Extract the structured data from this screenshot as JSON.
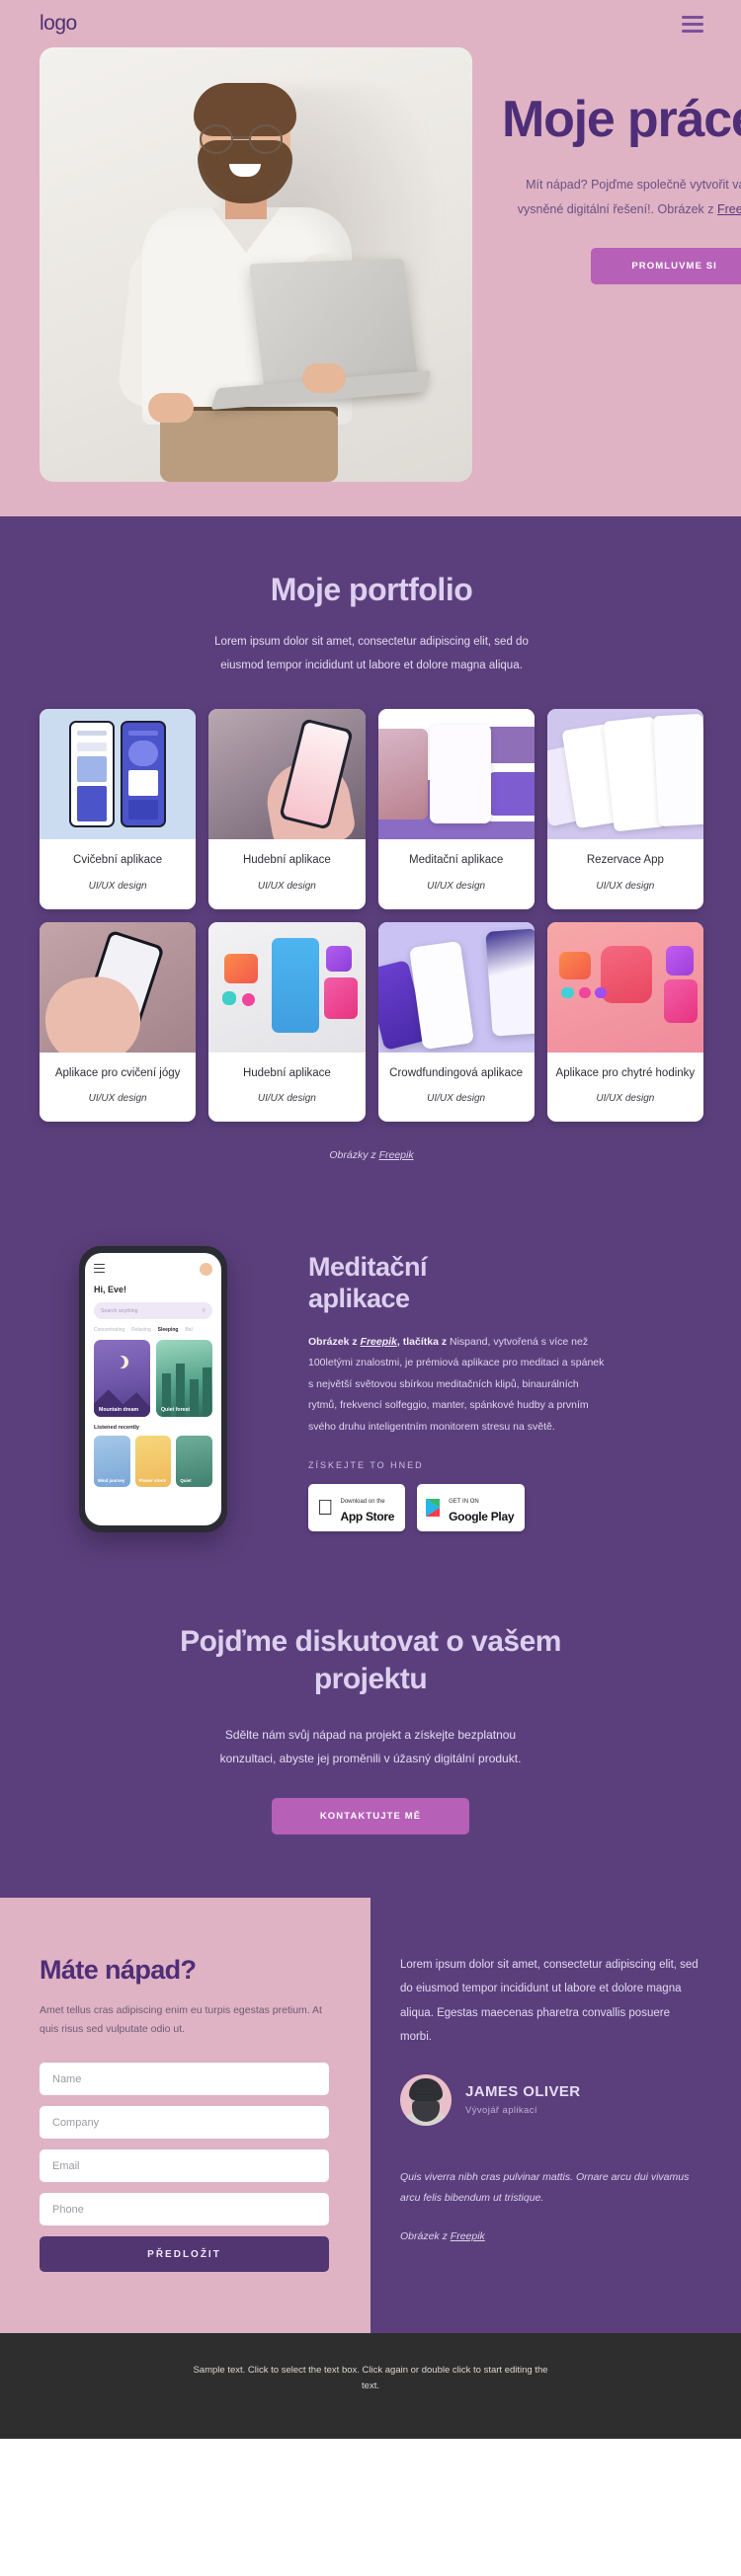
{
  "header": {
    "logo": "logo",
    "menu_icon": "hamburger-icon"
  },
  "hero": {
    "title": "Moje práce",
    "subtitle_line1": "Mít nápad? Pojďme společně vytvořit vaše",
    "subtitle_line2": "vysněné digitální řešení!. Obrázek z ",
    "subtitle_link": "Freepik",
    "button": "PROMLUVME SI"
  },
  "portfolio": {
    "title": "Moje portfolio",
    "subtitle_line1": "Lorem ipsum dolor sit amet, consectetur adipiscing elit, sed do",
    "subtitle_line2": "eiusmod tempor incididunt ut labore et dolore magna aliqua.",
    "cards": [
      {
        "name": "Cvičební aplikace",
        "tag": "UI/UX design"
      },
      {
        "name": "Hudební aplikace",
        "tag": "UI/UX design"
      },
      {
        "name": "Meditační aplikace",
        "tag": "UI/UX design"
      },
      {
        "name": "Rezervace  App",
        "tag": "UI/UX design"
      },
      {
        "name": "Aplikace pro cvičení jógy",
        "tag": "UI/UX design"
      },
      {
        "name": "Hudební aplikace",
        "tag": "UI/UX design"
      },
      {
        "name": "Crowdfundingová aplikace",
        "tag": "UI/UX design"
      },
      {
        "name": "Aplikace pro chytré hodinky",
        "tag": "UI/UX design"
      }
    ],
    "credit_prefix": "Obrázky z ",
    "credit_link": "Freepik"
  },
  "meditation": {
    "title_line1": "Meditační",
    "title_line2": "aplikace",
    "body_bold": "Obrázek z ",
    "body_link": "Freepik",
    "body_bold2": ", tlačítka z ",
    "body_rest": " Nispand, vytvořená s více než 100letými znalostmi, je prémiová aplikace pro meditaci a spánek s největší světovou sbírkou meditačních klipů, binaurálních rytmů, frekvencí solfeggio, manter, spánkové hudby a prvním svého druhu inteligentním monitorem stresu na světě.",
    "cta_label": "ZÍSKEJTE TO HNED",
    "appstore_small": "Download on the",
    "appstore_big": "App Store",
    "googleplay_small": "GET IN ON",
    "googleplay_big": "Google Play",
    "phone": {
      "greeting": "Hi, Eve!",
      "search_placeholder": "Search anything",
      "tabs": [
        "Concentrating",
        "Relaxing",
        "Sleeping",
        "Bal"
      ],
      "active_tab": "Sleeping",
      "card1": "Mountain dream",
      "card2": "Quiet forest",
      "recent_label": "Listened recently",
      "recent": [
        "Mind journey",
        "Flower storm",
        "Quiet"
      ]
    }
  },
  "discuss": {
    "title_line1": "Pojďme diskutovat o vašem",
    "title_line2": "projektu",
    "body_line1": "Sdělte nám svůj nápad na projekt a získejte bezplatnou",
    "body_line2": "konzultaci, abyste jej proměnili v úžasný digitální produkt.",
    "button": "KONTAKTUJTE MĚ"
  },
  "contact": {
    "title": "Máte nápad?",
    "description": "Amet tellus cras adipiscing enim eu turpis egestas pretium. At quis risus sed vulputate odio ut.",
    "fields": [
      {
        "placeholder": "Name",
        "value": ""
      },
      {
        "placeholder": "Company",
        "value": ""
      },
      {
        "placeholder": "Email",
        "value": ""
      },
      {
        "placeholder": "Phone",
        "value": ""
      }
    ],
    "submit": "PŘEDLOŽIT",
    "quote": "Lorem ipsum dolor sit amet, consectetur adipiscing elit, sed do eiusmod tempor incididunt ut labore et dolore magna aliqua. Egestas maecenas pharetra convallis posuere morbi.",
    "person_name": "JAMES OLIVER",
    "person_role": "Vývojář aplikací",
    "quote2": "Quis viverra nibh cras pulvinar mattis. Ornare arcu dui vivamus arcu felis bibendum ut tristique.",
    "credit_prefix": "Obrázek z ",
    "credit_link": "Freepik"
  },
  "footer": {
    "text": "Sample text. Click to select the text box. Click again or double click to start editing the text."
  },
  "colors": {
    "hero_bg": "#dfb3c3",
    "purple_bg": "#5b3f7d",
    "accent_pink": "#b660b8",
    "deep_purple": "#4f2e78",
    "footer_bg": "#2e2e2e"
  }
}
